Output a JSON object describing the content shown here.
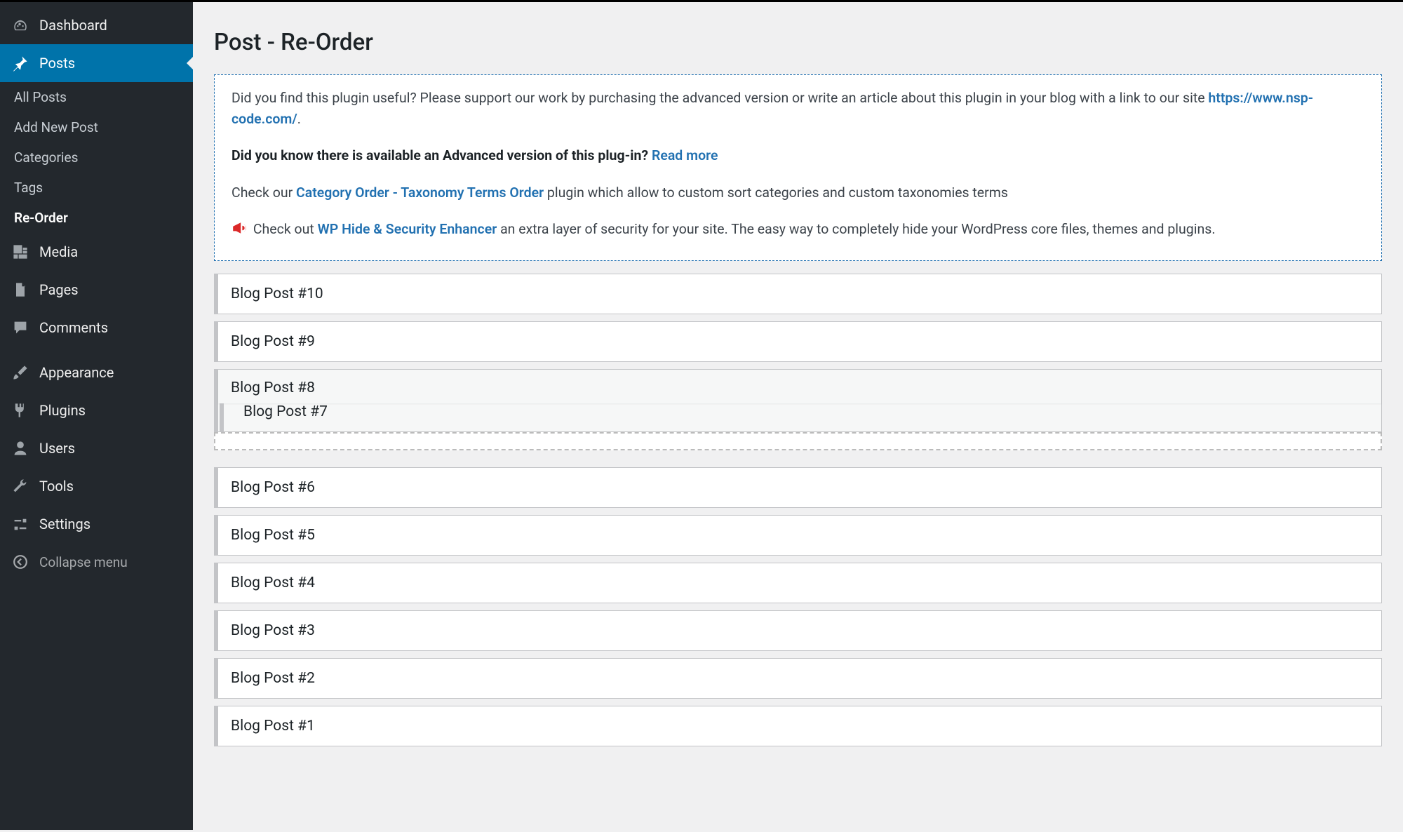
{
  "sidebar": {
    "items": [
      {
        "id": "dashboard",
        "label": "Dashboard",
        "icon": "dashboard-icon"
      },
      {
        "id": "posts",
        "label": "Posts",
        "icon": "pin-icon"
      },
      {
        "id": "media",
        "label": "Media",
        "icon": "media-icon"
      },
      {
        "id": "pages",
        "label": "Pages",
        "icon": "page-icon"
      },
      {
        "id": "comments",
        "label": "Comments",
        "icon": "comment-icon"
      },
      {
        "id": "appearance",
        "label": "Appearance",
        "icon": "brush-icon"
      },
      {
        "id": "plugins",
        "label": "Plugins",
        "icon": "plug-icon"
      },
      {
        "id": "users",
        "label": "Users",
        "icon": "user-icon"
      },
      {
        "id": "tools",
        "label": "Tools",
        "icon": "wrench-icon"
      },
      {
        "id": "settings",
        "label": "Settings",
        "icon": "sliders-icon"
      }
    ],
    "posts_submenu": [
      {
        "id": "all",
        "label": "All Posts"
      },
      {
        "id": "add",
        "label": "Add New Post"
      },
      {
        "id": "cats",
        "label": "Categories"
      },
      {
        "id": "tags",
        "label": "Tags"
      },
      {
        "id": "reorder",
        "label": "Re-Order"
      }
    ],
    "collapse_label": "Collapse menu"
  },
  "page": {
    "title": "Post - Re-Order"
  },
  "notice": {
    "p1_a": "Did you find this plugin useful? Please support our work by purchasing the advanced version or write an article about this plugin in your blog with a link to our site ",
    "p1_link": "https://www.nsp-code.com/",
    "p1_b": ".",
    "p2_a": "Did you know there is available an Advanced version of this plug-in? ",
    "p2_link": "Read more",
    "p3_a": "Check our ",
    "p3_link": "Category Order - Taxonomy Terms Order",
    "p3_b": " plugin which allow to custom sort categories and custom taxonomies terms",
    "p4_a": " Check out ",
    "p4_link": "WP Hide & Security Enhancer",
    "p4_b": " an extra layer of security for your site. The easy way to completely hide your WordPress core files, themes and plugins."
  },
  "posts": [
    {
      "title": "Blog Post #10"
    },
    {
      "title": "Blog Post #9"
    },
    {
      "title": "Blog Post #8"
    },
    {
      "title": "Blog Post #7"
    },
    {
      "title": "Blog Post #6"
    },
    {
      "title": "Blog Post #5"
    },
    {
      "title": "Blog Post #4"
    },
    {
      "title": "Blog Post #3"
    },
    {
      "title": "Blog Post #2"
    },
    {
      "title": "Blog Post #1"
    }
  ],
  "drag_state": {
    "dragging_indices": [
      2,
      3
    ],
    "placeholder_after_index": 3
  }
}
